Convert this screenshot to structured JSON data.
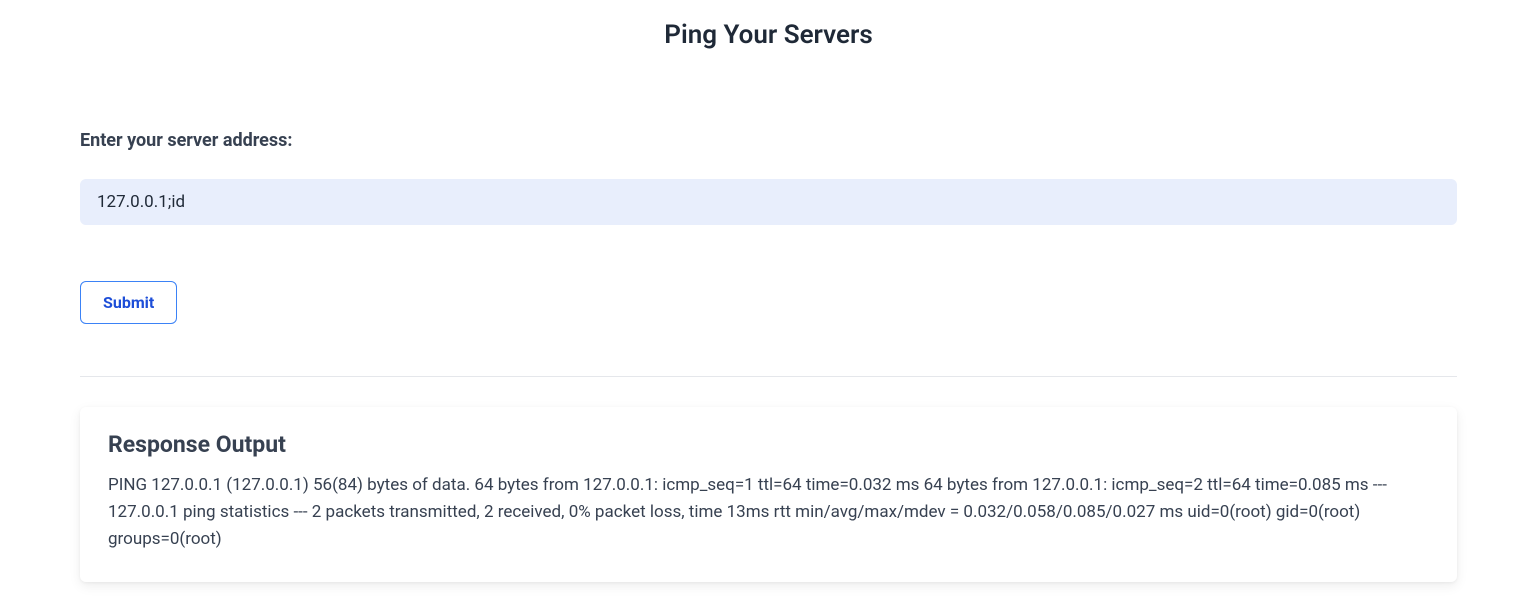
{
  "header": {
    "title": "Ping Your Servers"
  },
  "form": {
    "label": "Enter your server address:",
    "input_value": "127.0.0.1;id",
    "submit_label": "Submit"
  },
  "response": {
    "heading": "Response Output",
    "body": "PING 127.0.0.1 (127.0.0.1) 56(84) bytes of data. 64 bytes from 127.0.0.1: icmp_seq=1 ttl=64 time=0.032 ms 64 bytes from 127.0.0.1: icmp_seq=2 ttl=64 time=0.085 ms --- 127.0.0.1 ping statistics --- 2 packets transmitted, 2 received, 0% packet loss, time 13ms rtt min/avg/max/mdev = 0.032/0.058/0.085/0.027 ms uid=0(root) gid=0(root) groups=0(root)"
  }
}
